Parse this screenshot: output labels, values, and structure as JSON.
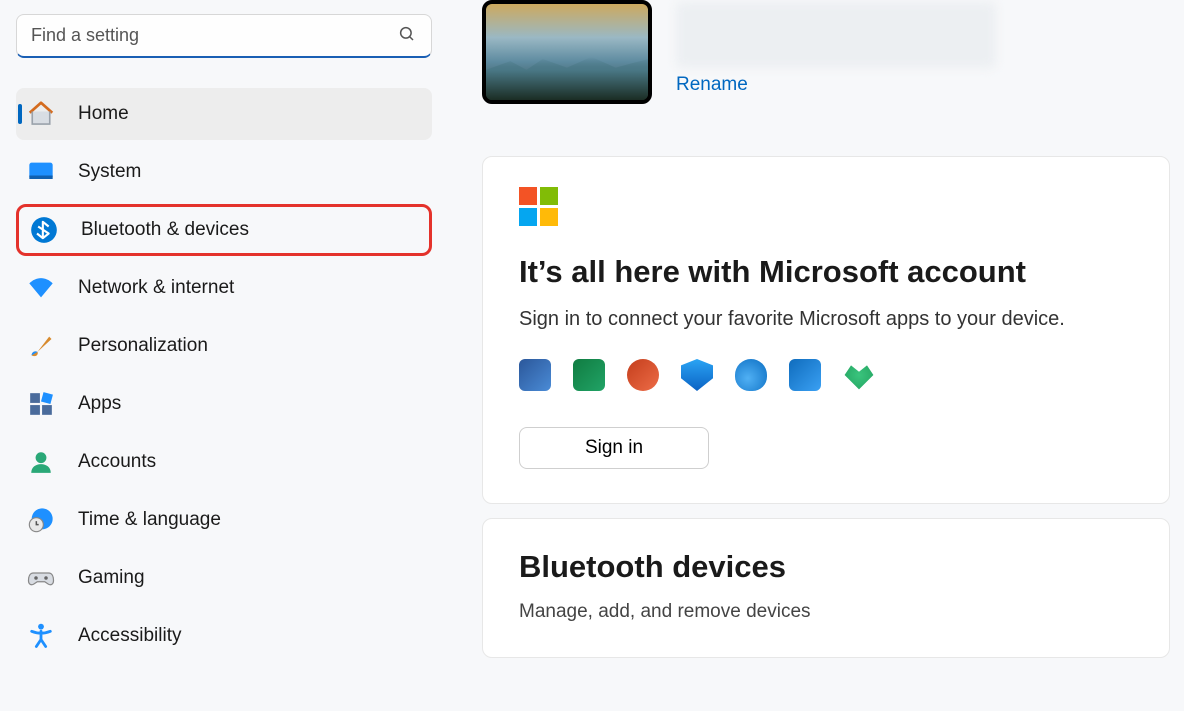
{
  "search": {
    "placeholder": "Find a setting"
  },
  "nav": [
    {
      "id": "home",
      "label": "Home",
      "active": true
    },
    {
      "id": "system",
      "label": "System"
    },
    {
      "id": "bluetooth",
      "label": "Bluetooth & devices",
      "highlighted": true
    },
    {
      "id": "network",
      "label": "Network & internet"
    },
    {
      "id": "personalization",
      "label": "Personalization"
    },
    {
      "id": "apps",
      "label": "Apps"
    },
    {
      "id": "accounts",
      "label": "Accounts"
    },
    {
      "id": "time",
      "label": "Time & language"
    },
    {
      "id": "gaming",
      "label": "Gaming"
    },
    {
      "id": "accessibility",
      "label": "Accessibility"
    }
  ],
  "device": {
    "rename": "Rename"
  },
  "ms_card": {
    "title": "It’s all here with Microsoft account",
    "subtitle": "Sign in to connect your favorite Microsoft apps to your device.",
    "signin": "Sign in",
    "apps": [
      "word",
      "excel",
      "powerpoint",
      "defender",
      "onedrive",
      "outlook",
      "family"
    ]
  },
  "bt_card": {
    "title": "Bluetooth devices",
    "subtitle": "Manage, add, and remove devices"
  }
}
